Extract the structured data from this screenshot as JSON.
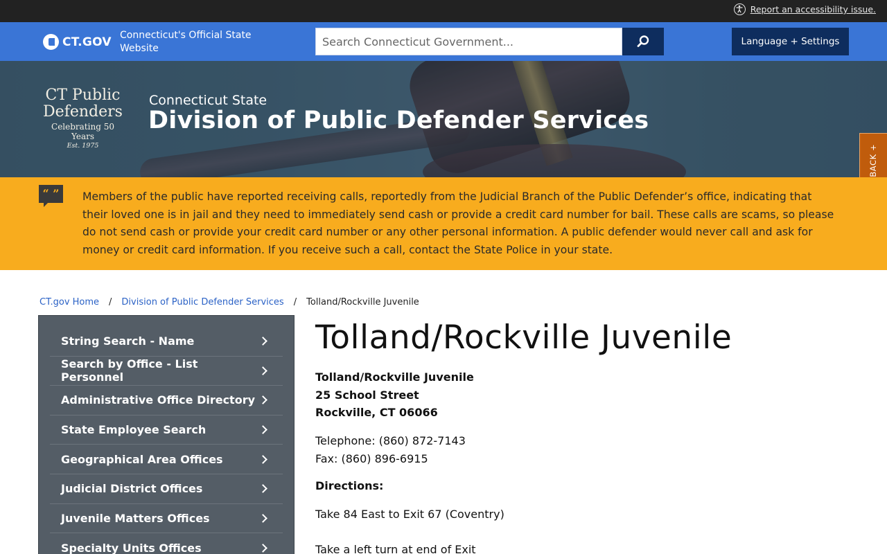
{
  "utility": {
    "accessibility_link": "Report an accessibility issue."
  },
  "ctgov": {
    "logo_text": "CT.GOV",
    "tagline": "Connecticut's Official State Website",
    "search_placeholder": "Search Connecticut Government...",
    "language_button": "Language + Settings"
  },
  "hero": {
    "logo_line1": "CT Public",
    "logo_line2": "Defenders",
    "logo_line3": "Celebrating 50 Years",
    "logo_line4": "Est. 1975",
    "kicker": "Connecticut State",
    "title": "Division of Public Defender Services"
  },
  "feedback": {
    "label": "FEEDBACK +"
  },
  "alert": {
    "text": "Members of the public have reported receiving calls, reportedly from the Judicial Branch of the Public Defender’s office, indicating that their loved one is in jail and they need to immediately send cash or provide a credit card number for bail. These calls are scams, so please do not send cash or provide your credit card number or any other personal information. A public defender would never call and ask for money or credit card information. If you receive such a call, contact the State Police in your state."
  },
  "breadcrumb": {
    "home": "CT.gov Home",
    "agency": "Division of Public Defender Services",
    "current": "Tolland/Rockville Juvenile"
  },
  "sidebar": {
    "items": [
      {
        "label": "String Search - Name"
      },
      {
        "label": "Search by Office - List Personnel"
      },
      {
        "label": "Administrative Office Directory"
      },
      {
        "label": "State Employee Search"
      },
      {
        "label": "Geographical Area Offices"
      },
      {
        "label": "Judicial District Offices"
      },
      {
        "label": "Juvenile Matters Offices"
      },
      {
        "label": "Specialty Units Offices"
      }
    ]
  },
  "main": {
    "title": "Tolland/Rockville Juvenile",
    "address_line1": "Tolland/Rockville Juvenile",
    "address_line2": "25 School Street",
    "address_line3": "Rockville, CT 06066",
    "telephone": "Telephone: (860) 872-7143",
    "fax": "Fax: (860) 896-6915",
    "directions_label": "Directions:",
    "directions_1": "Take 84 East to Exit 67 (Coventry)",
    "directions_2": "Take a left turn at end of Exit"
  },
  "colors": {
    "utility_bg": "#222222",
    "ctgov_blue": "#3a75d6",
    "navy": "#0e2d5e",
    "alert_yellow": "#f8ac1e",
    "sidebar_gray": "#545d66",
    "feedback_orange": "#c05c0c"
  }
}
